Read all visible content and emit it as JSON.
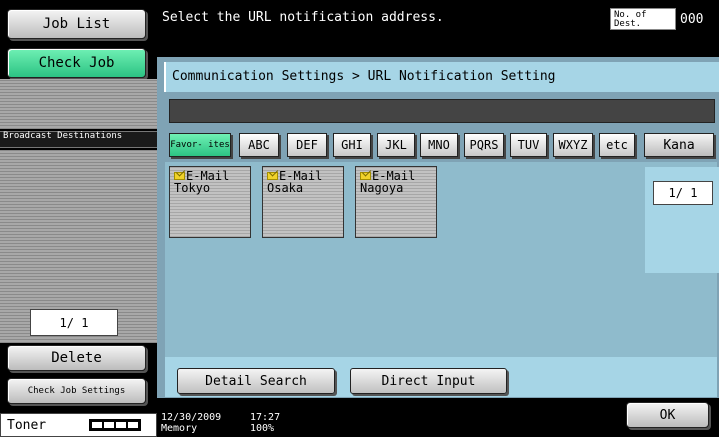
{
  "sidebar": {
    "job_list": "Job List",
    "check_job": "Check Job",
    "broadcast_label": "Broadcast Destinations",
    "counter": "1/ 1",
    "delete": "Delete",
    "check_job_settings": "Check Job Settings",
    "toner_label": "Toner",
    "toner_level": "4/4"
  },
  "header": {
    "message": "Select the URL notification address.",
    "dest_label": "No. of Dest.",
    "dest_count": "000"
  },
  "main": {
    "breadcrumb": "Communication Settings > URL Notification Setting",
    "tabs": [
      {
        "label": "Favor- ites"
      },
      {
        "label": "ABC"
      },
      {
        "label": "DEF"
      },
      {
        "label": "GHI"
      },
      {
        "label": "JKL"
      },
      {
        "label": "MNO"
      },
      {
        "label": "PQRS"
      },
      {
        "label": "TUV"
      },
      {
        "label": "WXYZ"
      },
      {
        "label": "etc"
      },
      {
        "label": "Kana"
      }
    ],
    "destinations": [
      {
        "type": "E-Mail",
        "name": "Tokyo"
      },
      {
        "type": "E-Mail",
        "name": "Osaka"
      },
      {
        "type": "E-Mail",
        "name": "Nagoya"
      }
    ],
    "page_counter": "1/ 1",
    "detail_search": "Detail Search",
    "direct_input": "Direct Input"
  },
  "footer": {
    "date": "12/30/2009",
    "memory_label": "Memory",
    "time": "17:27",
    "memory_value": "100%",
    "ok": "OK"
  },
  "colors": {
    "main_bg": "#7fa3b5",
    "title_bg": "#a6d5e6",
    "accent_green": "#2cc383",
    "mail_icon": "#f0d22a"
  },
  "icons": [
    "envelope-icon"
  ]
}
